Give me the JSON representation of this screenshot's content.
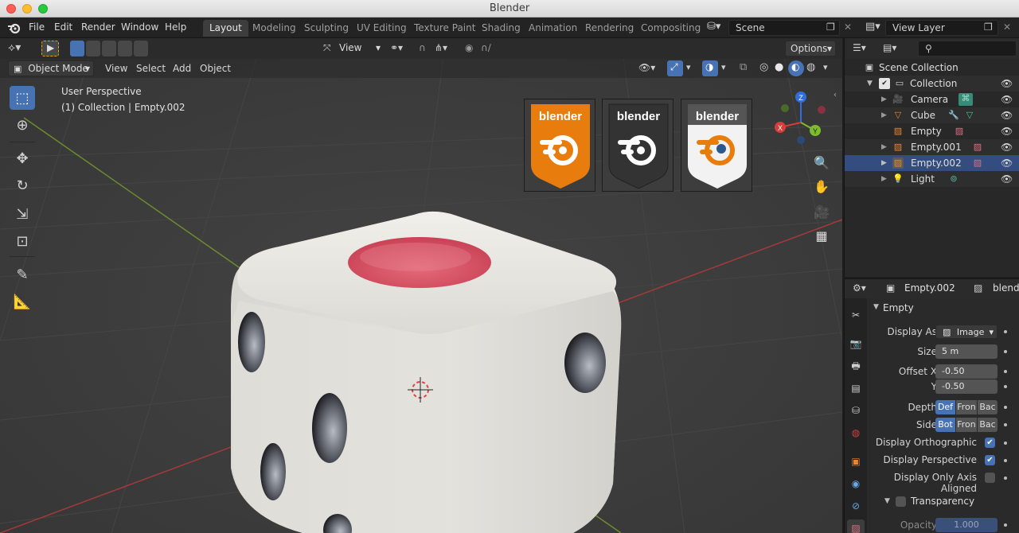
{
  "window": {
    "title": "Blender"
  },
  "menubar": {
    "file": "File",
    "edit": "Edit",
    "render": "Render",
    "window": "Window",
    "help": "Help"
  },
  "workspaces": [
    "Layout",
    "Modeling",
    "Sculpting",
    "UV Editing",
    "Texture Paint",
    "Shading",
    "Animation",
    "Rendering",
    "Compositing"
  ],
  "scene": {
    "name": "Scene",
    "view_layer": "View Layer"
  },
  "viewport": {
    "view_dropdown": "View",
    "options": "Options",
    "mode": "Object Mode",
    "menu": {
      "view": "View",
      "select": "Select",
      "add": "Add",
      "object": "Object"
    },
    "overlay_line1": "User Perspective",
    "overlay_line2": "(1) Collection | Empty.002",
    "logo_text": "blender",
    "gizmo": {
      "x": "X",
      "y": "Y",
      "z": "Z"
    },
    "colors": {
      "orange": "#e87d0d",
      "dark": "#333333",
      "white": "#f2f2f2",
      "dice": "#e6e4df",
      "pip": "#e0566a"
    }
  },
  "outliner": {
    "root": "Scene Collection",
    "collection": "Collection",
    "items": [
      {
        "label": "Camera",
        "icon": "camera-icon"
      },
      {
        "label": "Cube",
        "icon": "mesh-icon"
      },
      {
        "label": "Empty",
        "icon": "image-empty-icon"
      },
      {
        "label": "Empty.001",
        "icon": "image-empty-icon"
      },
      {
        "label": "Empty.002",
        "icon": "image-empty-icon"
      },
      {
        "label": "Light",
        "icon": "light-icon"
      }
    ]
  },
  "properties": {
    "object_name": "Empty.002",
    "data_name": "blende",
    "panel_title": "Empty",
    "display_as_label": "Display As",
    "display_as_value": "Image",
    "size_label": "Size",
    "size_value": "5 m",
    "offset_x_label": "Offset X",
    "offset_x_value": "-0.50",
    "offset_y_label": "Y",
    "offset_y_value": "-0.50",
    "depth_label": "Depth",
    "depth_options": [
      "Def",
      "Fron",
      "Bac"
    ],
    "side_label": "Side",
    "side_options": [
      "Bot",
      "Fron",
      "Bac"
    ],
    "display_ortho": "Display Orthographic",
    "display_persp": "Display Perspective",
    "display_axis": "Display Only Axis Aligned",
    "transparency": "Transparency",
    "opacity_label": "Opacity",
    "opacity_value": "1.000"
  }
}
